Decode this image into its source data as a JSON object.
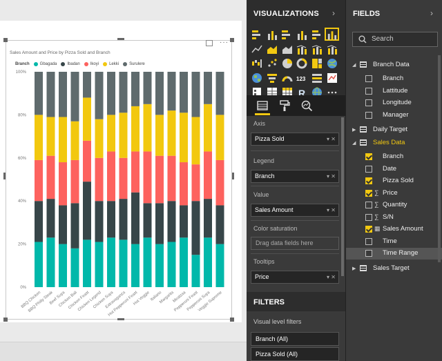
{
  "visual": {
    "title": "Sales Amount and Price by Pizza Sold and Branch",
    "legend_title": "Branch",
    "more_label": "···"
  },
  "chart_data": {
    "type": "bar",
    "stacked": "100%",
    "title": "Sales Amount and Price by Pizza Sold and Branch",
    "legend_title": "Branch",
    "legend_placement": "top-left",
    "categories": [
      "BBQ Chicken",
      "BBQ Philly Steak",
      "Beef Suya",
      "Chicken Bali",
      "Chicken Feast",
      "Chicken Legend",
      "Chicken Suya",
      "Extravaganza",
      "Hot Pepperoni Feast",
      "Hot Veggie",
      "Italiano",
      "Margarita",
      "Meatzaa",
      "Pepperoni Feast",
      "Pepperoni Suya",
      "Veggie Supreme"
    ],
    "yticks": [
      "0%",
      "20%",
      "40%",
      "60%",
      "80%",
      "100%"
    ],
    "ylim": [
      0,
      100
    ],
    "series": [
      {
        "name": "Gbagada",
        "color": "#01b8aa",
        "values": [
          21,
          23,
          20,
          18,
          22,
          21,
          23,
          22,
          20,
          23,
          20,
          21,
          23,
          15,
          23,
          20
        ]
      },
      {
        "name": "Ibadan",
        "color": "#374649",
        "values": [
          19,
          18,
          18,
          21,
          27,
          19,
          17,
          19,
          24,
          16,
          19,
          19,
          15,
          25,
          18,
          18
        ]
      },
      {
        "name": "Ikoyi",
        "color": "#fd625e",
        "values": [
          19,
          20,
          20,
          20,
          19,
          20,
          23,
          19,
          19,
          24,
          22,
          21,
          20,
          17,
          22,
          21
        ]
      },
      {
        "name": "Lekki",
        "color": "#f2c80f",
        "values": [
          21,
          18,
          21,
          18,
          20,
          18,
          17,
          21,
          21,
          22,
          19,
          21,
          23,
          22,
          22,
          21
        ]
      },
      {
        "name": "Surulere",
        "color": "#5f6b6d",
        "values": [
          20,
          21,
          21,
          23,
          12,
          22,
          20,
          19,
          16,
          15,
          20,
          18,
          19,
          21,
          15,
          20
        ]
      }
    ]
  },
  "visualizations_pane": {
    "title": "VISUALIZATIONS",
    "chevron": "›",
    "wells": {
      "axis_label": "Axis",
      "axis_value": "Pizza Sold",
      "legend_label": "Legend",
      "legend_value": "Branch",
      "value_label": "Value",
      "value_value": "Sales Amount",
      "color_sat_label": "Color saturation",
      "color_sat_placeholder": "Drag data fields here",
      "tooltips_label": "Tooltips",
      "tooltips_value": "Price"
    },
    "filters": {
      "title": "FILTERS",
      "visual_level_label": "Visual level filters",
      "items": [
        "Branch  (All)",
        "Pizza Sold  (All)"
      ]
    }
  },
  "fields_pane": {
    "title": "FIELDS",
    "chevron": "›",
    "search_placeholder": "Search",
    "tables": [
      {
        "name": "Branch Data",
        "expanded": true,
        "fields": [
          {
            "name": "Branch",
            "checked": false,
            "sigma": false
          },
          {
            "name": "Lattitude",
            "checked": false,
            "sigma": false
          },
          {
            "name": "Longitude",
            "checked": false,
            "sigma": false
          },
          {
            "name": "Manager",
            "checked": false,
            "sigma": false
          }
        ]
      },
      {
        "name": "Daily Target",
        "expanded": false,
        "fields": []
      },
      {
        "name": "Sales Data",
        "expanded": true,
        "highlight": true,
        "fields": [
          {
            "name": "Branch",
            "checked": true,
            "sigma": false
          },
          {
            "name": "Date",
            "checked": false,
            "sigma": false
          },
          {
            "name": "Pizza Sold",
            "checked": true,
            "sigma": false
          },
          {
            "name": "Price",
            "checked": true,
            "sigma": true
          },
          {
            "name": "Quantity",
            "checked": false,
            "sigma": true
          },
          {
            "name": "S/N",
            "checked": false,
            "sigma": true
          },
          {
            "name": "Sales Amount",
            "checked": true,
            "sigma": false,
            "calc": true
          },
          {
            "name": "Time",
            "checked": false,
            "sigma": false
          },
          {
            "name": "Time Range",
            "checked": false,
            "sigma": false,
            "active": true
          }
        ]
      },
      {
        "name": "Sales Target",
        "expanded": false,
        "fields": []
      }
    ]
  },
  "colors": {
    "accent": "#f2c811",
    "pane_dark": "#2d2d2d",
    "pane_mid": "#3a3a3a"
  }
}
